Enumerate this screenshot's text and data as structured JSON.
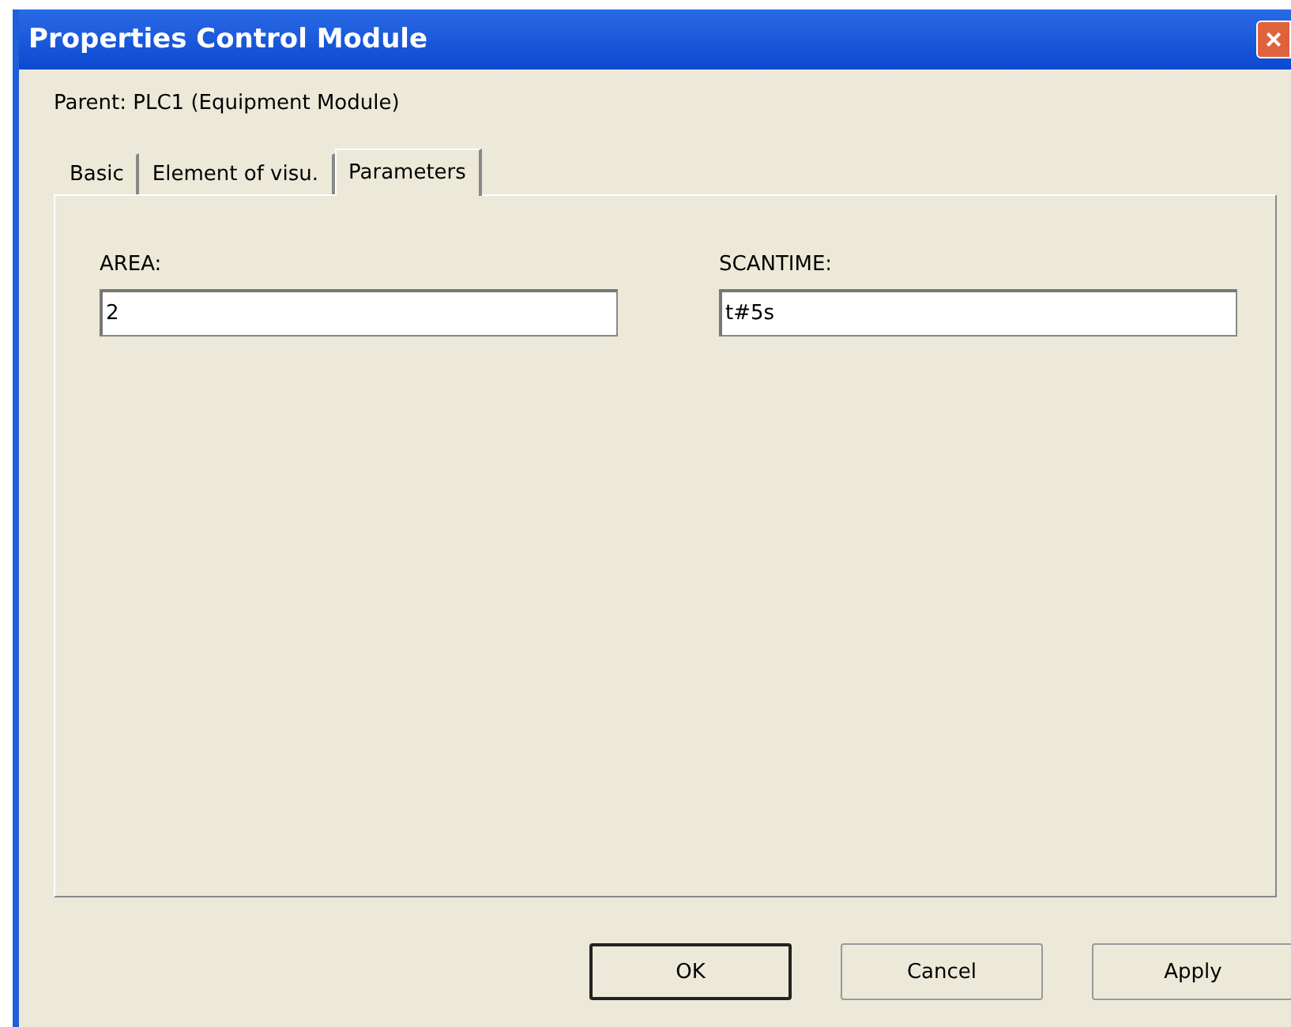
{
  "window": {
    "title": "Properties Control Module",
    "close": "×"
  },
  "parent": "Parent: PLC1 (Equipment Module)",
  "tabs": [
    {
      "label": "Basic",
      "selected": false
    },
    {
      "label": "Element of visu.",
      "selected": false
    },
    {
      "label": "Parameters",
      "selected": true
    }
  ],
  "fields": [
    {
      "label": "AREA:",
      "value": "2"
    },
    {
      "label": "SCANTIME:",
      "value": "t#5s"
    }
  ],
  "buttons": [
    {
      "label": "OK",
      "default": true
    },
    {
      "label": "Cancel",
      "default": false
    },
    {
      "label": "Apply",
      "default": false
    }
  ]
}
